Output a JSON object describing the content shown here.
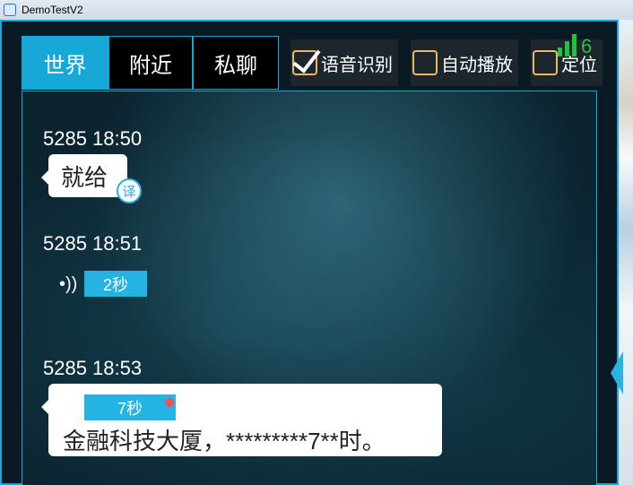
{
  "window": {
    "title": "DemoTestV2"
  },
  "tabs": [
    {
      "label": "世界",
      "active": true
    },
    {
      "label": "附近",
      "active": false
    },
    {
      "label": "私聊",
      "active": false
    }
  ],
  "options": [
    {
      "label": "语音识别",
      "checked": true
    },
    {
      "label": "自动播放",
      "checked": false
    },
    {
      "label": "定位",
      "checked": false
    }
  ],
  "signal": {
    "level": 6,
    "color": "#23c23a"
  },
  "messages": [
    {
      "header": "5285 18:50",
      "type": "text",
      "text": "就给",
      "translate_label": "译"
    },
    {
      "header": "5285 18:51",
      "type": "voice",
      "duration": "2秒"
    },
    {
      "header": "5285 18:53",
      "type": "voice_text",
      "duration": "7秒",
      "text": "金融科技大厦，*********7**时。",
      "unread": true
    }
  ],
  "colors": {
    "accent": "#1aa6d6",
    "checkbox_border": "#e8b96a"
  }
}
